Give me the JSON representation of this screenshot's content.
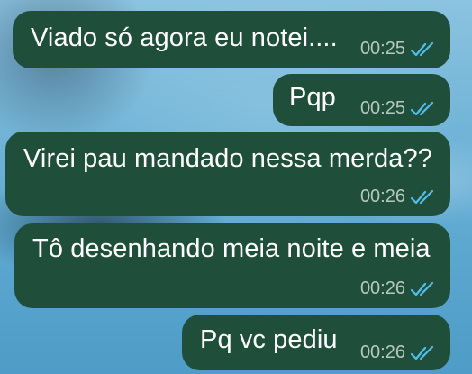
{
  "chat": {
    "messages": [
      {
        "text": "Viado só agora eu notei....",
        "time": "00:25",
        "status_icon": "double-check-read-icon"
      },
      {
        "text": "Pqp",
        "time": "00:25",
        "status_icon": "double-check-read-icon"
      },
      {
        "text": "Virei pau mandado nessa merda??",
        "time": "00:26",
        "status_icon": "double-check-read-icon"
      },
      {
        "text": "Tô desenhando meia noite e meia",
        "time": "00:26",
        "status_icon": "double-check-read-icon"
      },
      {
        "text": "Pq vc pediu",
        "time": "00:26",
        "status_icon": "double-check-read-icon"
      }
    ]
  },
  "colors": {
    "bubble_background": "#1f4f3b",
    "message_text": "#ffffff",
    "timestamp_text": "#b7c9bf",
    "read_ticks": "#53bdeb"
  }
}
